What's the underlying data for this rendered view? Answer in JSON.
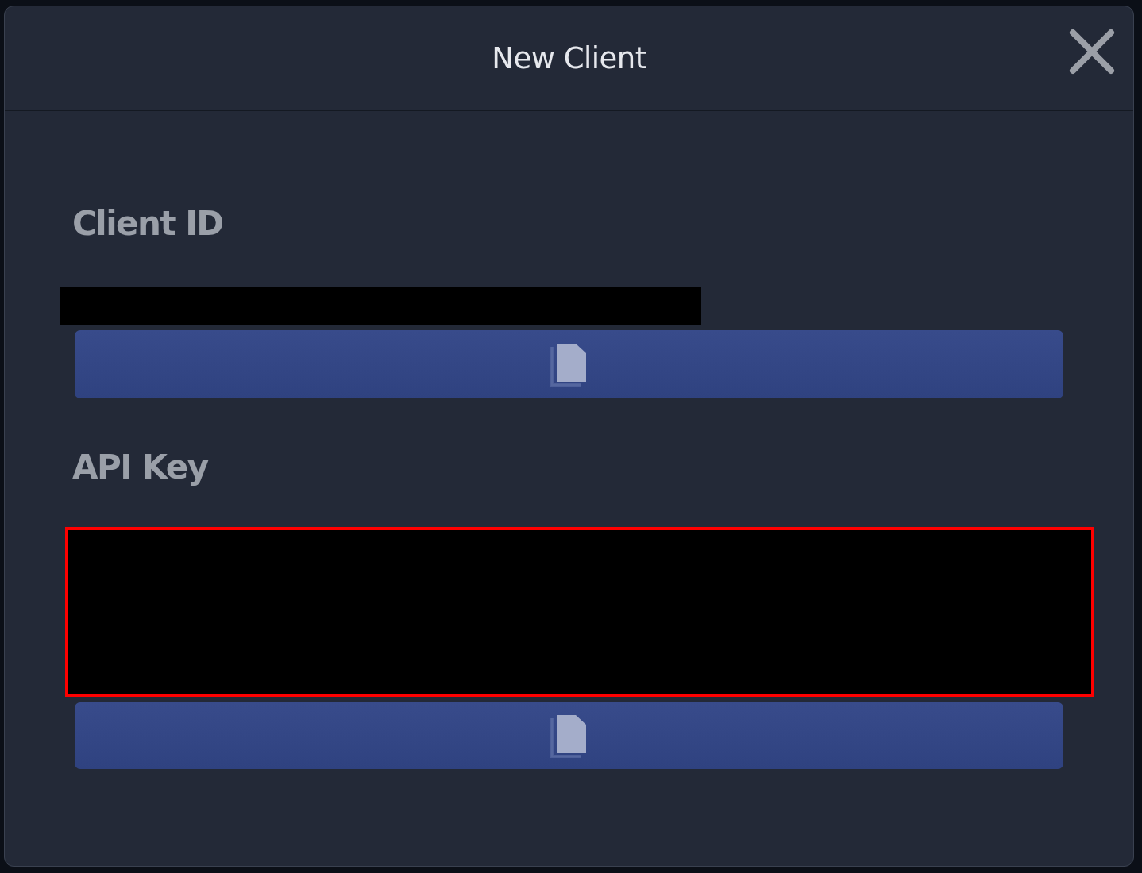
{
  "dialog": {
    "title": "New Client"
  },
  "fields": [
    {
      "label": "Client ID",
      "kind": "line",
      "highlighted": false
    },
    {
      "label": "API Key",
      "kind": "block",
      "highlighted": true
    }
  ]
}
